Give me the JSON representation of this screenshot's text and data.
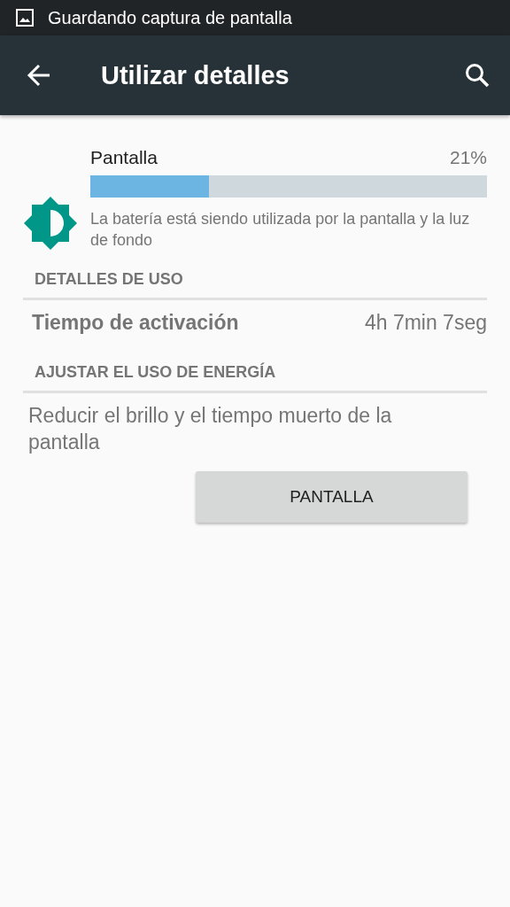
{
  "status_bar": {
    "notification": "Guardando captura de pantalla"
  },
  "toolbar": {
    "title": "Utilizar detalles"
  },
  "usage": {
    "name": "Pantalla",
    "percent": "21%",
    "level": 0.3,
    "description": "La batería está siendo utilizada por la pantalla y la luz de fondo"
  },
  "sections": [
    {
      "header": "DETALLES DE USO",
      "kind": "detail",
      "label": "Tiempo de activación",
      "value": "4h 7min 7seg"
    },
    {
      "header": "AJUSTAR EL USO DE ENERGÍA",
      "kind": "action",
      "text": "Reducir el brillo y el tiempo muerto de la pantalla",
      "button": "PANTALLA"
    }
  ]
}
